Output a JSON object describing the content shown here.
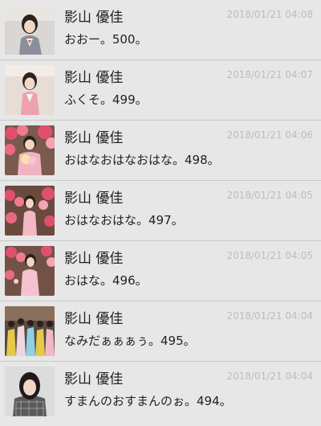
{
  "messages": [
    {
      "sender": "影山 優佳",
      "time": "2018/01/21 04:08",
      "text": "おおー。500。",
      "thumbnail": "photo-girl-uniform"
    },
    {
      "sender": "影山 優佳",
      "time": "2018/01/21 04:07",
      "text": "ふくそ。499。",
      "thumbnail": "photo-girl-pink-cardigan"
    },
    {
      "sender": "影山 優佳",
      "time": "2018/01/21 04:06",
      "text": "おはなおはなおはな。498。",
      "thumbnail": "photo-flowers-bouquet"
    },
    {
      "sender": "影山 優佳",
      "time": "2018/01/21 04:05",
      "text": "おはなおはな。497。",
      "thumbnail": "photo-flowers-standing"
    },
    {
      "sender": "影山 優佳",
      "time": "2018/01/21 04:05",
      "text": "おはな。496。",
      "thumbnail": "photo-flowers-pose"
    },
    {
      "sender": "影山 優佳",
      "time": "2018/01/21 04:04",
      "text": "なみだぁぁぁぅ。495。",
      "thumbnail": "photo-group-stage"
    },
    {
      "sender": "影山 優佳",
      "time": "2018/01/21 04:04",
      "text": "すまんのおすまんのぉ。494。",
      "thumbnail": "photo-girl-plaid"
    }
  ]
}
